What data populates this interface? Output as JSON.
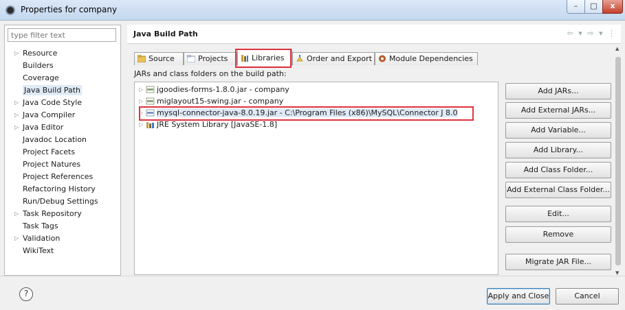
{
  "window": {
    "title": "Properties for company",
    "controls": {
      "minimize": "–",
      "maximize": "□",
      "close": "x"
    }
  },
  "sidebar": {
    "filter_placeholder": "type filter text",
    "items": [
      {
        "label": "Resource",
        "expandable": true
      },
      {
        "label": "Builders",
        "expandable": false
      },
      {
        "label": "Coverage",
        "expandable": false
      },
      {
        "label": "Java Build Path",
        "expandable": false,
        "selected": true
      },
      {
        "label": "Java Code Style",
        "expandable": true
      },
      {
        "label": "Java Compiler",
        "expandable": true
      },
      {
        "label": "Java Editor",
        "expandable": true
      },
      {
        "label": "Javadoc Location",
        "expandable": false
      },
      {
        "label": "Project Facets",
        "expandable": false
      },
      {
        "label": "Project Natures",
        "expandable": false
      },
      {
        "label": "Project References",
        "expandable": false
      },
      {
        "label": "Refactoring History",
        "expandable": false
      },
      {
        "label": "Run/Debug Settings",
        "expandable": false
      },
      {
        "label": "Task Repository",
        "expandable": true
      },
      {
        "label": "Task Tags",
        "expandable": false
      },
      {
        "label": "Validation",
        "expandable": true
      },
      {
        "label": "WikiText",
        "expandable": false
      }
    ]
  },
  "header": {
    "title": "Java Build Path",
    "nav_icons": "⇦ ▾ ⇨ ▾ ⋮"
  },
  "tabs": [
    {
      "label": "Source",
      "icon": "source-folder-icon"
    },
    {
      "label": "Projects",
      "icon": "projects-icon"
    },
    {
      "label": "Libraries",
      "icon": "libraries-icon",
      "active": true
    },
    {
      "label": "Order and Export",
      "icon": "order-export-icon"
    },
    {
      "label": "Module Dependencies",
      "icon": "module-icon"
    }
  ],
  "main": {
    "jars_label": "JARs and class folders on the build path:",
    "entries": [
      {
        "label": "jgoodies-forms-1.8.0.jar - company",
        "icon": "jar-icon"
      },
      {
        "label": "miglayout15-swing.jar - company",
        "icon": "jar-icon"
      },
      {
        "label": "mysql-connector-java-8.0.19.jar - C:\\Program Files (x86)\\MySQL\\Connector J 8.0",
        "icon": "jar-icon",
        "selected": true
      },
      {
        "label": "JRE System Library [JavaSE-1.8]",
        "icon": "library-icon"
      }
    ],
    "buttons": {
      "add_jars": "Add JARs...",
      "add_external_jars": "Add External JARs...",
      "add_variable": "Add Variable...",
      "add_library": "Add Library...",
      "add_class_folder": "Add Class Folder...",
      "add_external_class_folder": "Add External Class Folder...",
      "edit": "Edit...",
      "remove": "Remove",
      "migrate_jar": "Migrate JAR File..."
    }
  },
  "footer": {
    "help": "?",
    "apply_close": "Apply and Close",
    "cancel": "Cancel"
  },
  "colors": {
    "highlight": "#e0313b",
    "selection": "#dfeaf7"
  }
}
